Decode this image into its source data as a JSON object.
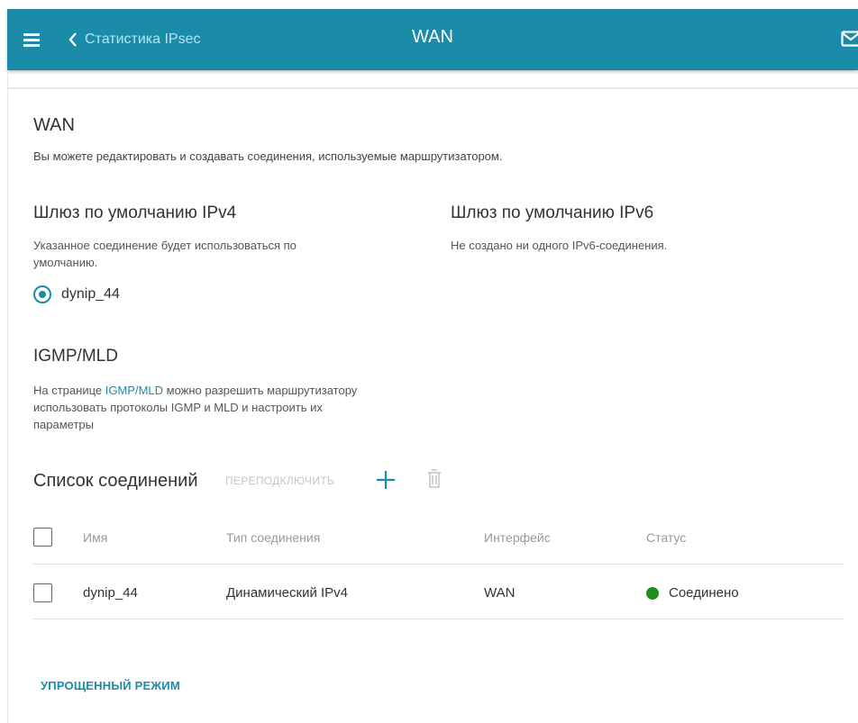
{
  "header": {
    "back_label": "Статистика IPsec",
    "title": "WAN",
    "color": "#1a8ba8"
  },
  "page": {
    "heading": "WAN",
    "description": "Вы можете редактировать и создавать соединения, используемые маршрутизатором."
  },
  "gateway_ipv4": {
    "heading": "Шлюз по умолчанию IPv4",
    "text_line1": "Указанное соединение будет использоваться по",
    "text_line2": "умолчанию.",
    "selected_connection": "dynip_44"
  },
  "gateway_ipv6": {
    "heading": "Шлюз по умолчанию IPv6",
    "text": "Не создано ни одного IPv6-соединения."
  },
  "igmp": {
    "heading": "IGMP/MLD",
    "line1_prefix": "На странице ",
    "line1_link": "IGMP/MLD",
    "line1_suffix": " можно разрешить маршрутизатору",
    "line2": "использовать протоколы IGMP и MLD и настроить их",
    "line3": "параметры"
  },
  "connections": {
    "heading": "Список соединений",
    "reconnect_label": "ПЕРЕПОДКЛЮЧИТЬ",
    "columns": [
      "Имя",
      "Тип соединения",
      "Интерфейс",
      "Статус"
    ],
    "rows": [
      {
        "name": "dynip_44",
        "type": "Динамический IPv4",
        "interface": "WAN",
        "status": "Соединено",
        "status_color": "#1e8e1e"
      }
    ]
  },
  "footer": {
    "simple_mode_label": "УПРОЩЕННЫЙ РЕЖИМ"
  }
}
